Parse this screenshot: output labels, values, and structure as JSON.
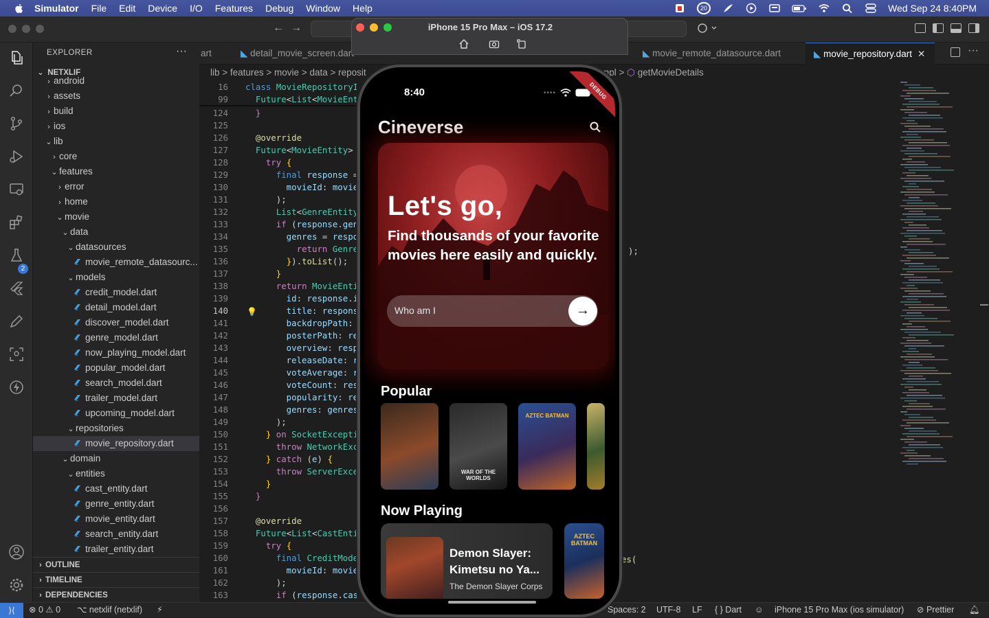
{
  "menubar": {
    "app": "Simulator",
    "items": [
      "File",
      "Edit",
      "Device",
      "I/O",
      "Features",
      "Debug",
      "Window",
      "Help"
    ],
    "notif_count": "20",
    "datetime": "Wed Sep 24  8:40PM"
  },
  "sidebar": {
    "title": "EXPLORER",
    "project": "NETXLIF",
    "tree": [
      {
        "label": "android",
        "depth": 1,
        "kind": "folder",
        "open": false
      },
      {
        "label": "assets",
        "depth": 1,
        "kind": "folder",
        "open": false
      },
      {
        "label": "build",
        "depth": 1,
        "kind": "folder",
        "open": false
      },
      {
        "label": "ios",
        "depth": 1,
        "kind": "folder",
        "open": false
      },
      {
        "label": "lib",
        "depth": 1,
        "kind": "folder",
        "open": true
      },
      {
        "label": "core",
        "depth": 2,
        "kind": "folder",
        "open": false
      },
      {
        "label": "features",
        "depth": 2,
        "kind": "folder",
        "open": true
      },
      {
        "label": "error",
        "depth": 3,
        "kind": "folder",
        "open": false
      },
      {
        "label": "home",
        "depth": 3,
        "kind": "folder",
        "open": false
      },
      {
        "label": "movie",
        "depth": 3,
        "kind": "folder",
        "open": true
      },
      {
        "label": "data",
        "depth": 4,
        "kind": "folder",
        "open": true
      },
      {
        "label": "datasources",
        "depth": 5,
        "kind": "folder",
        "open": true
      },
      {
        "label": "movie_remote_datasourc...",
        "depth": 6,
        "kind": "dart"
      },
      {
        "label": "models",
        "depth": 5,
        "kind": "folder",
        "open": true
      },
      {
        "label": "credit_model.dart",
        "depth": 6,
        "kind": "dart"
      },
      {
        "label": "detail_model.dart",
        "depth": 6,
        "kind": "dart"
      },
      {
        "label": "discover_model.dart",
        "depth": 6,
        "kind": "dart"
      },
      {
        "label": "genre_model.dart",
        "depth": 6,
        "kind": "dart"
      },
      {
        "label": "now_playing_model.dart",
        "depth": 6,
        "kind": "dart"
      },
      {
        "label": "popular_model.dart",
        "depth": 6,
        "kind": "dart"
      },
      {
        "label": "search_model.dart",
        "depth": 6,
        "kind": "dart"
      },
      {
        "label": "trailer_model.dart",
        "depth": 6,
        "kind": "dart"
      },
      {
        "label": "upcoming_model.dart",
        "depth": 6,
        "kind": "dart"
      },
      {
        "label": "repositories",
        "depth": 5,
        "kind": "folder",
        "open": true
      },
      {
        "label": "movie_repository.dart",
        "depth": 6,
        "kind": "dart",
        "selected": true
      },
      {
        "label": "domain",
        "depth": 4,
        "kind": "folder",
        "open": true
      },
      {
        "label": "entities",
        "depth": 5,
        "kind": "folder",
        "open": true
      },
      {
        "label": "cast_entity.dart",
        "depth": 6,
        "kind": "dart"
      },
      {
        "label": "genre_entity.dart",
        "depth": 6,
        "kind": "dart"
      },
      {
        "label": "movie_entity.dart",
        "depth": 6,
        "kind": "dart"
      },
      {
        "label": "search_entity.dart",
        "depth": 6,
        "kind": "dart"
      },
      {
        "label": "trailer_entity.dart",
        "depth": 6,
        "kind": "dart"
      }
    ],
    "sections": [
      "OUTLINE",
      "TIMELINE",
      "DEPENDENCIES"
    ]
  },
  "tabs": {
    "t0": "art",
    "t1": "detail_movie_screen.dart",
    "t3": "movie_remote_datasource.dart",
    "t4": "movie_repository.dart"
  },
  "breadcrumbs": {
    "left": "lib > features > movie > data > reposit",
    "right_mid": "mpl",
    "right": "getMovieDetails"
  },
  "code": {
    "lines": [
      {
        "n": "16",
        "html": "<span class='kw'>class</span> <span class='ty'>MovieRepositoryImp</span>"
      },
      {
        "n": "99",
        "html": "  <span class='ty'>Future</span><span class='pu'>&lt;</span><span class='ty'>List</span><span class='pu'>&lt;</span><span class='ty'>MovieEnti</span>"
      },
      {
        "n": "124",
        "html": "  <span class='br2'>}</span>"
      },
      {
        "n": "125",
        "html": ""
      },
      {
        "n": "126",
        "html": "  <span class='an'>@override</span>"
      },
      {
        "n": "127",
        "html": "  <span class='ty'>Future</span><span class='pu'>&lt;</span><span class='ty'>MovieEntity</span><span class='pu'>&gt;</span> <span class='an'>g</span>"
      },
      {
        "n": "128",
        "html": "    <span class='kw2'>try</span> <span class='br'>{</span>"
      },
      {
        "n": "129",
        "html": "      <span class='kw'>final</span> response <span class='pu'>=</span>"
      },
      {
        "n": "130",
        "html": "        movieId<span class='pu'>:</span> moviel"
      },
      {
        "n": "131",
        "html": "      <span class='pu'>);</span>"
      },
      {
        "n": "132",
        "html": "      <span class='ty'>List</span><span class='pu'>&lt;</span><span class='ty'>GenreEntity</span>"
      },
      {
        "n": "133",
        "html": "      <span class='kw2'>if</span> <span class='pu'>(</span>response<span class='pu'>.</span>geni"
      },
      {
        "n": "134",
        "html": "        genres <span class='pu'>=</span> respo"
      },
      {
        "n": "135",
        "html": "          <span class='kw2'>return</span> <span class='ty'>Genre</span>"
      },
      {
        "n": "136",
        "html": "        <span class='br'>}</span><span class='pu'>).</span><span class='an'>toList</span><span class='pu'>();</span>"
      },
      {
        "n": "137",
        "html": "      <span class='br'>}</span>"
      },
      {
        "n": "138",
        "html": "      <span class='kw2'>return</span> <span class='ty'>MovieEntit</span>"
      },
      {
        "n": "139",
        "html": "        id<span class='pu'>:</span> response<span class='pu'>.</span>ic"
      },
      {
        "n": "140",
        "html": "        title<span class='pu'>:</span> response"
      },
      {
        "n": "141",
        "html": "        backdropPath<span class='pu'>:</span> r"
      },
      {
        "n": "142",
        "html": "        posterPath<span class='pu'>:</span> res"
      },
      {
        "n": "143",
        "html": "        overview<span class='pu'>:</span> respo"
      },
      {
        "n": "144",
        "html": "        releaseDate<span class='pu'>:</span> re"
      },
      {
        "n": "145",
        "html": "        voteAverage<span class='pu'>:</span> re"
      },
      {
        "n": "146",
        "html": "        voteCount<span class='pu'>:</span> resp"
      },
      {
        "n": "147",
        "html": "        popularity<span class='pu'>:</span> res"
      },
      {
        "n": "148",
        "html": "        genres<span class='pu'>:</span> genres<span class='pu'>,</span>"
      },
      {
        "n": "149",
        "html": "      <span class='pu'>);</span>"
      },
      {
        "n": "150",
        "html": "    <span class='br'>}</span> <span class='kw2'>on</span> <span class='ty'>SocketExceptio</span>"
      },
      {
        "n": "151",
        "html": "      <span class='kw2'>throw</span> <span class='ty'>NetworkExce</span>"
      },
      {
        "n": "152",
        "html": "    <span class='br'>}</span> <span class='kw2'>catch</span> <span class='pu'>(</span>e<span class='pu'>)</span> <span class='br'>{</span>"
      },
      {
        "n": "153",
        "html": "      <span class='kw2'>throw</span> <span class='ty'>ServerExcep</span>"
      },
      {
        "n": "154",
        "html": "    <span class='br'>}</span>"
      },
      {
        "n": "155",
        "html": "  <span class='br2'>}</span>"
      },
      {
        "n": "156",
        "html": ""
      },
      {
        "n": "157",
        "html": "  <span class='an'>@override</span>"
      },
      {
        "n": "158",
        "html": "  <span class='ty'>Future</span><span class='pu'>&lt;</span><span class='ty'>List</span><span class='pu'>&lt;</span><span class='ty'>CastEntit</span>"
      },
      {
        "n": "159",
        "html": "    <span class='kw2'>try</span> <span class='br'>{</span>"
      },
      {
        "n": "160",
        "html": "      <span class='kw'>final</span> <span class='ty'>CreditModel</span>"
      },
      {
        "n": "161",
        "html": "        movieId<span class='pu'>:</span> moviel"
      },
      {
        "n": "162",
        "html": "      <span class='pu'>);</span>"
      },
      {
        "n": "163",
        "html": "      <span class='kw2'>if</span> <span class='pu'>(</span>response<span class='pu'>.</span>cast"
      }
    ],
    "current_line": "140",
    "right_fragment_1": ");",
    "right_fragment_2": "es("
  },
  "status": {
    "problems": "0",
    "warnings": "0",
    "branch": "netxlif (netxlif)",
    "spaces": "Spaces: 2",
    "encoding": "UTF-8",
    "eol": "LF",
    "language": "Dart",
    "device": "iPhone 15 Pro Max (ios simulator)",
    "formatter": "Prettier"
  },
  "simulator": {
    "title": "iPhone 15 Pro Max – iOS 17.2",
    "phone": {
      "time": "8:40",
      "debug_label": "DEBUG",
      "app_title": "Cineverse",
      "hero_heading": "Let's go,",
      "hero_text": "Find thousands of your favorite movies here easily and quickly.",
      "search_placeholder": "Who am I",
      "popular_title": "Popular",
      "posters": [
        {
          "label": "",
          "colors": [
            "#3b2a1e",
            "#8b4a2a",
            "#2b3d58"
          ]
        },
        {
          "label": "WAR OF THE WORLDS",
          "colors": [
            "#2a2a2a",
            "#4a4a4a",
            "#151515"
          ]
        },
        {
          "label": "AZTEC BATMAN",
          "colors": [
            "#2a4f93",
            "#3a2b5a",
            "#c0642a"
          ]
        },
        {
          "label": "",
          "colors": [
            "#c9b36a",
            "#3c5a2e",
            "#a37c2b"
          ]
        }
      ],
      "now_playing_title": "Now Playing",
      "now_playing": {
        "title": "Demon Slayer: Kimetsu no Ya...",
        "subtitle": "The Demon Slayer Corps"
      }
    }
  },
  "colors": {
    "accent": "#3b78d6",
    "hero_red": "#8c1d1f",
    "debug_red": "#b4282e"
  }
}
